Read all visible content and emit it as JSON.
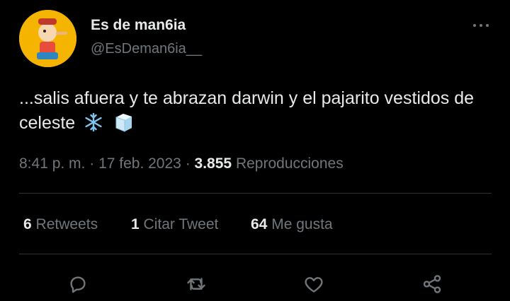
{
  "author": {
    "name": "Es de man6ia",
    "handle": "@EsDeman6ia__",
    "avatar_icon": "pinocchio-avatar-icon"
  },
  "tweet": {
    "text": "...salis afuera y te abrazan darwin y el pajarito vestidos de celeste",
    "emojis": [
      "snowflake-icon",
      "ice-cube-icon"
    ]
  },
  "meta": {
    "time": "8:41 p. m.",
    "sep1": "·",
    "date": "17 feb. 2023",
    "sep2": "·",
    "views_count": "3.855",
    "views_label": "Reproducciones"
  },
  "stats": {
    "retweets_count": "6",
    "retweets_label": "Retweets",
    "quotes_count": "1",
    "quotes_label": "Citar Tweet",
    "likes_count": "64",
    "likes_label": "Me gusta"
  },
  "actions": [
    "reply-icon",
    "retweet-icon",
    "like-icon",
    "share-icon"
  ],
  "colors": {
    "background": "#000000",
    "text": "#e7e9ea",
    "secondary": "#71767b",
    "divider": "#2f3336"
  }
}
